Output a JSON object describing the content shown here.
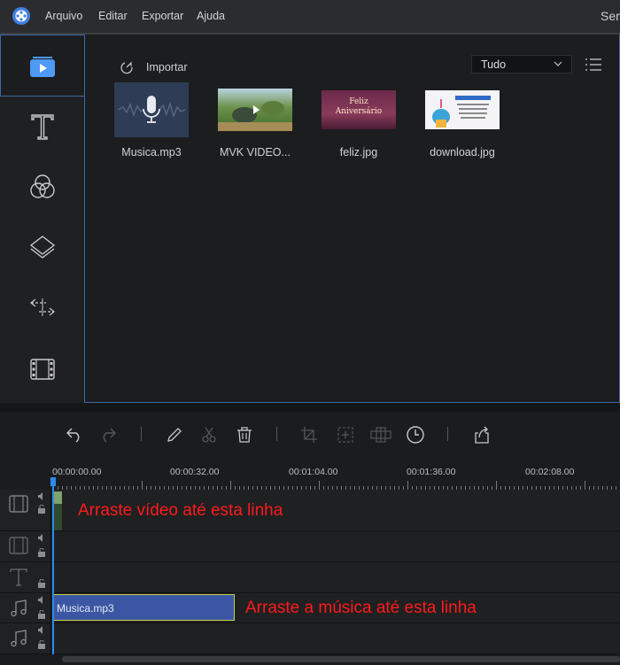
{
  "menubar": {
    "items": [
      "Arquivo",
      "Editar",
      "Exportar",
      "Ajuda"
    ],
    "right_text": "Sem"
  },
  "rail": {
    "items": [
      "media",
      "text",
      "filters",
      "overlays",
      "transitions",
      "elements"
    ]
  },
  "media_panel": {
    "import_label": "Importar",
    "filter_value": "Tudo",
    "files": [
      {
        "name": "Musica.mp3",
        "kind": "audio"
      },
      {
        "name": "MVK VIDEO...",
        "kind": "video"
      },
      {
        "name": "feliz.jpg",
        "kind": "image",
        "thumb_text_1": "Feliz",
        "thumb_text_2": "Aniversário"
      },
      {
        "name": "download.jpg",
        "kind": "image"
      }
    ]
  },
  "toolbar": {
    "buttons": [
      "undo",
      "redo",
      "edit",
      "cut",
      "delete",
      "crop",
      "zoom",
      "mosaic",
      "duration",
      "export"
    ]
  },
  "ruler": {
    "labels": [
      "00:00:00.00",
      "00:00:32.00",
      "00:01:04.00",
      "00:01:36.00",
      "00:02:08.00"
    ]
  },
  "tracks": {
    "music_clip_label": "Musica.mp3",
    "annotation_video": "Arraste vídeo até esta linha",
    "annotation_music": "Arraste a música até esta linha"
  },
  "colors": {
    "accent": "#2c8cf0",
    "panel_border": "#3a6aa8",
    "music_clip": "#3b57a3",
    "annotation": "#ff1a1a"
  }
}
